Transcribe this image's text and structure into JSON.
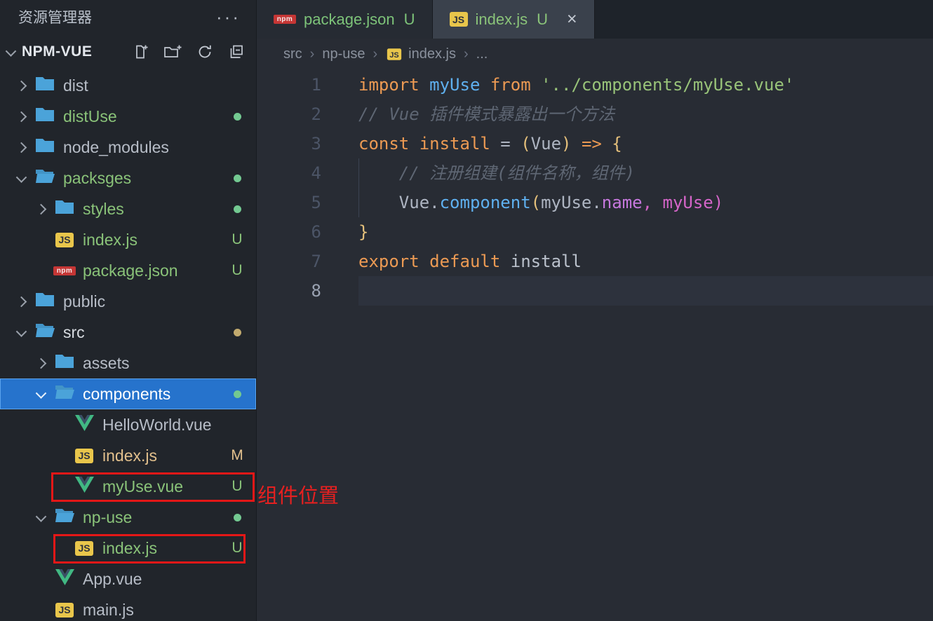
{
  "sidebar": {
    "title": "资源管理器",
    "section_label": "NPM-VUE",
    "tree": [
      {
        "label": "dist",
        "type": "folder",
        "level": 0,
        "chevron": "right",
        "color": "default"
      },
      {
        "label": "distUse",
        "type": "folder",
        "level": 0,
        "chevron": "right",
        "color": "green",
        "dot": "green"
      },
      {
        "label": "node_modules",
        "type": "folder",
        "level": 0,
        "chevron": "right",
        "color": "default"
      },
      {
        "label": "packsges",
        "type": "folder-open",
        "level": 0,
        "chevron": "down",
        "color": "green",
        "dot": "green"
      },
      {
        "label": "styles",
        "type": "folder",
        "level": 1,
        "chevron": "right",
        "color": "green",
        "dot": "green"
      },
      {
        "label": "index.js",
        "type": "js",
        "level": 1,
        "badge": "U",
        "color": "green"
      },
      {
        "label": "package.json",
        "type": "npm",
        "level": 1,
        "badge": "U",
        "color": "green"
      },
      {
        "label": "public",
        "type": "folder",
        "level": 0,
        "chevron": "right",
        "color": "default"
      },
      {
        "label": "src",
        "type": "folder-open",
        "level": 0,
        "chevron": "down",
        "color": "bright",
        "dot": "tan"
      },
      {
        "label": "assets",
        "type": "folder",
        "level": 1,
        "chevron": "right",
        "color": "default"
      },
      {
        "label": "components",
        "type": "folder-open",
        "level": 1,
        "chevron": "down",
        "color": "bright",
        "dot": "green",
        "selected": true
      },
      {
        "label": "HelloWorld.vue",
        "type": "vue",
        "level": 2,
        "color": "default"
      },
      {
        "label": "index.js",
        "type": "js",
        "level": 2,
        "badge": "M",
        "color": "gold"
      },
      {
        "label": "myUse.vue",
        "type": "vue",
        "level": 2,
        "badge": "U",
        "color": "green"
      },
      {
        "label": "np-use",
        "type": "folder-open",
        "level": 1,
        "chevron": "down",
        "color": "green",
        "dot": "green"
      },
      {
        "label": "index.js",
        "type": "js",
        "level": 2,
        "badge": "U",
        "color": "green"
      },
      {
        "label": "App.vue",
        "type": "vue",
        "level": 1,
        "color": "default"
      },
      {
        "label": "main.js",
        "type": "js",
        "level": 1,
        "color": "default"
      }
    ]
  },
  "editor": {
    "tabs": [
      {
        "icon": "npm",
        "label": "package.json",
        "dirty": "U",
        "active": false
      },
      {
        "icon": "js",
        "label": "index.js",
        "dirty": "U",
        "active": true,
        "close": "×"
      }
    ],
    "breadcrumb": [
      {
        "label": "src"
      },
      {
        "label": "np-use"
      },
      {
        "label": "index.js",
        "icon": "js"
      },
      {
        "label": "..."
      }
    ],
    "code_lines": [
      {
        "n": "1",
        "tokens": [
          [
            "k",
            "import"
          ],
          [
            "p",
            " "
          ],
          [
            "b",
            "myUse"
          ],
          [
            "p",
            " "
          ],
          [
            "k",
            "from"
          ],
          [
            "p",
            " "
          ],
          [
            "s",
            "'../components/myUse.vue'"
          ]
        ]
      },
      {
        "n": "2",
        "tokens": [
          [
            "c",
            "// Vue 插件模式暴露出一个方法"
          ]
        ]
      },
      {
        "n": "3",
        "tokens": [
          [
            "k",
            "const"
          ],
          [
            "p",
            " "
          ],
          [
            "k",
            "install"
          ],
          [
            "p",
            " = "
          ],
          [
            "y",
            "("
          ],
          [
            "p",
            "Vue"
          ],
          [
            "y",
            ")"
          ],
          [
            "p",
            " "
          ],
          [
            "k",
            "=>"
          ],
          [
            "p",
            " "
          ],
          [
            "y",
            "{"
          ]
        ]
      },
      {
        "n": "4",
        "guide": true,
        "tokens": [
          [
            "c",
            "    // 注册组建(组件名称，组件)"
          ]
        ]
      },
      {
        "n": "5",
        "guide": true,
        "tokens": [
          [
            "p",
            "    Vue."
          ],
          [
            "b",
            "component"
          ],
          [
            "y",
            "("
          ],
          [
            "p",
            "myUse."
          ],
          [
            "pu",
            "name"
          ],
          [
            "m",
            ", myUse)"
          ]
        ]
      },
      {
        "n": "6",
        "tokens": [
          [
            "y",
            "}"
          ]
        ]
      },
      {
        "n": "7",
        "tokens": [
          [
            "k",
            "export"
          ],
          [
            "p",
            " "
          ],
          [
            "k",
            "default"
          ],
          [
            "p",
            " "
          ],
          [
            "p2",
            "install"
          ]
        ]
      },
      {
        "n": "8",
        "current": true,
        "tokens": []
      }
    ]
  },
  "annotations": {
    "label": "组件位置"
  }
}
